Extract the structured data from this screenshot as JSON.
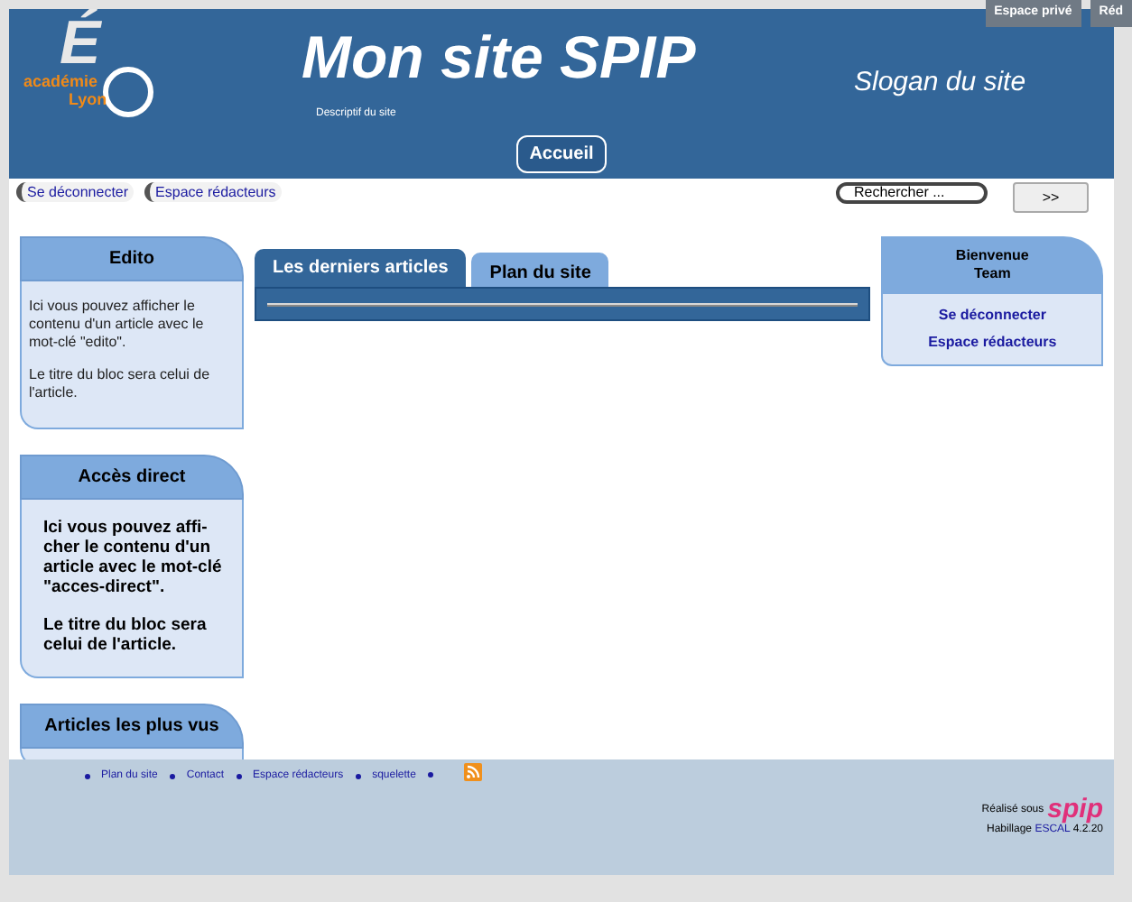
{
  "top_tabs": [
    "Espace privé",
    "Réd"
  ],
  "header": {
    "logo": {
      "mark": "É",
      "line1": "académie",
      "line2": "Lyon"
    },
    "title": "Mon site SPIP",
    "slogan": "Slogan du site",
    "description": "Descriptif du site",
    "menu": [
      {
        "label": "Accueil",
        "selected": true
      }
    ]
  },
  "user_links": [
    "Se déconnecter",
    "Espace rédacteurs"
  ],
  "search": {
    "placeholder": "Rechercher ...",
    "button": ">>"
  },
  "left_blocks": [
    {
      "title": "Edito",
      "kind": "plain",
      "paragraphs": [
        "Ici vous pouvez afficher le contenu d'un article avec le mot-clé \"edito\".",
        "Le titre du bloc sera celui de l'article."
      ]
    },
    {
      "title": "Accès direct",
      "kind": "bold",
      "paragraphs": [
        "Ici vous pouvez affi-cher le contenu d'un article avec le mot-clé \"acces-direct\".",
        "Le titre du bloc sera celui de l'article."
      ]
    },
    {
      "title": "Articles les plus vus",
      "kind": "plain"
    }
  ],
  "tabs": [
    {
      "label": "Les derniers articles",
      "selected": true
    },
    {
      "label": "Plan du site",
      "selected": false
    }
  ],
  "welcome": {
    "title": "Bienvenue",
    "user": "Team",
    "links": [
      "Se déconnecter",
      "Espace rédacteurs"
    ]
  },
  "footer": {
    "links": [
      "Plan du site",
      "Contact",
      "Espace rédacteurs",
      "squelette"
    ],
    "made_with": "Réalisé sous",
    "spip": "spip",
    "theme_prefix": "Habillage",
    "theme_name": "ESCAL",
    "theme_version": "4.2.20"
  }
}
